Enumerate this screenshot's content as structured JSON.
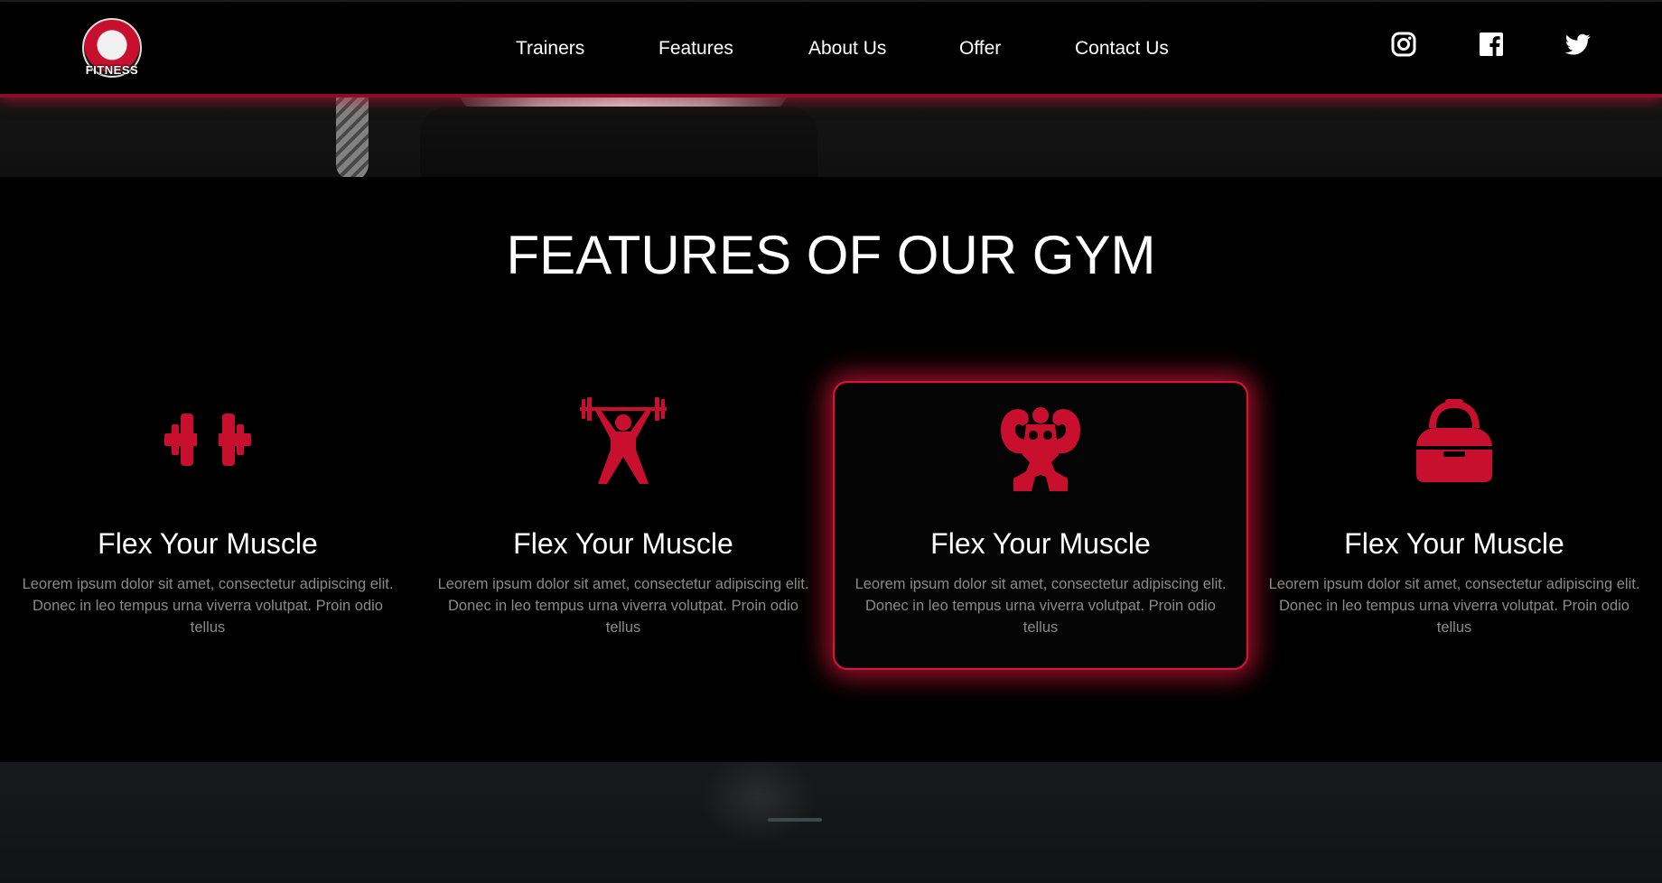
{
  "header": {
    "logo_text": "FITNESS",
    "nav": [
      {
        "label": "Trainers"
      },
      {
        "label": "Features"
      },
      {
        "label": "About Us"
      },
      {
        "label": "Offer"
      },
      {
        "label": "Contact Us"
      }
    ],
    "social": [
      "instagram-icon",
      "facebook-icon",
      "twitter-icon"
    ]
  },
  "features": {
    "title": "FEATURES OF OUR GYM",
    "cards": [
      {
        "icon": "dumbbell-icon",
        "title": "Flex Your Muscle",
        "text": "Leorem ipsum dolor sit amet, consectetur adipiscing elit. Donec in leo tempus urna viverra volutpat. Proin odio tellus"
      },
      {
        "icon": "weightlifter-icon",
        "title": "Flex Your Muscle",
        "text": "Leorem ipsum dolor sit amet, consectetur adipiscing elit. Donec in leo tempus urna viverra volutpat. Proin odio tellus"
      },
      {
        "icon": "bodybuilder-icon",
        "title": "Flex Your Muscle",
        "text": "Leorem ipsum dolor sit amet, consectetur adipiscing elit. Donec in leo tempus urna viverra volutpat. Proin odio tellus"
      },
      {
        "icon": "gym-bag-icon",
        "title": "Flex Your Muscle",
        "text": "Leorem ipsum dolor sit amet, consectetur adipiscing elit. Donec in leo tempus urna viverra volutpat. Proin odio tellus"
      }
    ],
    "active_card": 2
  },
  "colors": {
    "accent": "#d3173b",
    "background": "#000000",
    "muted_text": "#8a8a8a"
  }
}
